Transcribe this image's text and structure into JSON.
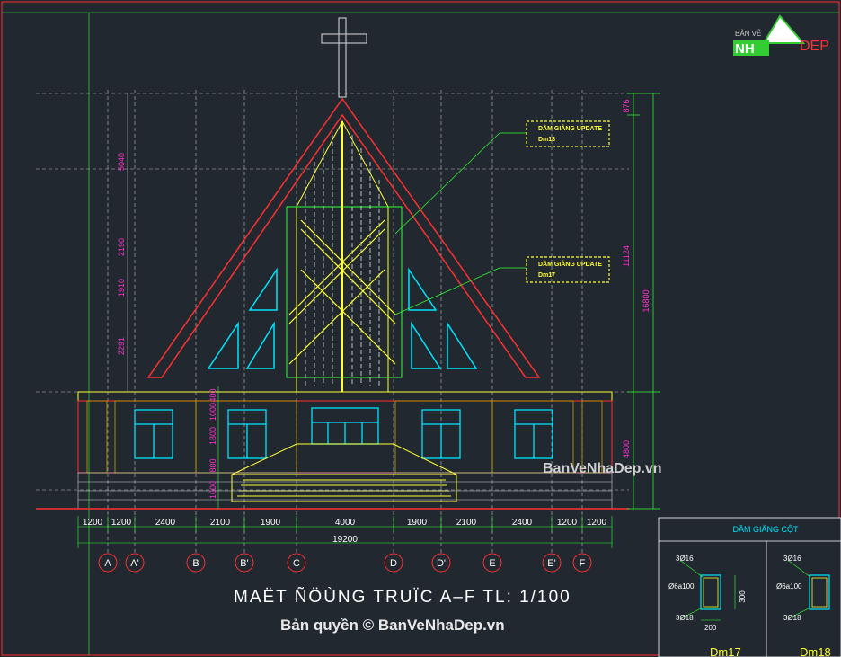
{
  "drawing": {
    "title": "MAËT ÑÖÙNG TRUÏC A–F TL: 1/100",
    "watermark_mid": "BanVeNhaDep.vn",
    "watermark_bottom": "Bản quyền © BanVeNhaDep.vn",
    "logo_small": "BẢN VẼ",
    "logo_nh": "NH",
    "logo_dep": "DEP"
  },
  "callouts": {
    "top_label": "DẦM GIẰNG UPDATE",
    "top_code": "Dm18",
    "mid_label": "DẦM GIẰNG UPDATE",
    "mid_code": "Dm17"
  },
  "dimensions": {
    "bottom": [
      "1200",
      "1200",
      "2400",
      "2100",
      "1900",
      "4000",
      "1900",
      "2100",
      "2400",
      "1200",
      "1200"
    ],
    "total": "19200",
    "right_top": "876",
    "right_mid": "11124",
    "right_total": "16800",
    "right_bottom": "4800",
    "left_v": [
      "5040",
      "2190",
      "1910",
      "2291"
    ],
    "left_small": [
      "400",
      "1000",
      "1800",
      "800",
      "1000"
    ]
  },
  "axes": [
    "A",
    "A'",
    "B",
    "B'",
    "C",
    "D",
    "D'",
    "E",
    "E'",
    "F"
  ],
  "detail_panel": {
    "title": "DẦM GIẰNG CỘT",
    "rebar_top": "3Ø16",
    "stirrup": "Ø6a100",
    "rebar_bottom": "3Ø18",
    "height": "300",
    "width": "200",
    "label_a": "Dm17",
    "label_b": "Dm18"
  },
  "colors": {
    "background": "#212830",
    "frame": "#ff2b2b",
    "roof": "#ff3030",
    "glass": "#00e5ff",
    "dim_line": "#33ff33",
    "annotation": "#ffff33",
    "wood": "#c8a000"
  }
}
